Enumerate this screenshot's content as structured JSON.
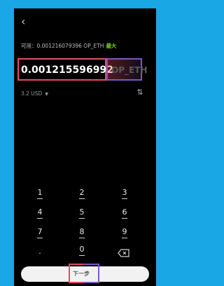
{
  "header": {
    "back_icon": "‹"
  },
  "balance": {
    "available_label": "可用：0.001216079396 OP_ETH",
    "max_label": "最大"
  },
  "amount": {
    "value": "0.001215596992",
    "unit": "OP_ETH"
  },
  "fiat": {
    "value": "3.2 USD",
    "caret": "▼",
    "swap_icon": "⇅"
  },
  "keypad": {
    "keys": [
      "1",
      "2",
      "3",
      "4",
      "5",
      "6",
      "7",
      "8",
      "9",
      ".",
      "0"
    ]
  },
  "footer": {
    "next_label": "下一步"
  },
  "colors": {
    "accent_green": "#7ed321",
    "highlight_red": "#e84a5f",
    "highlight_purple": "#7e57c2"
  }
}
